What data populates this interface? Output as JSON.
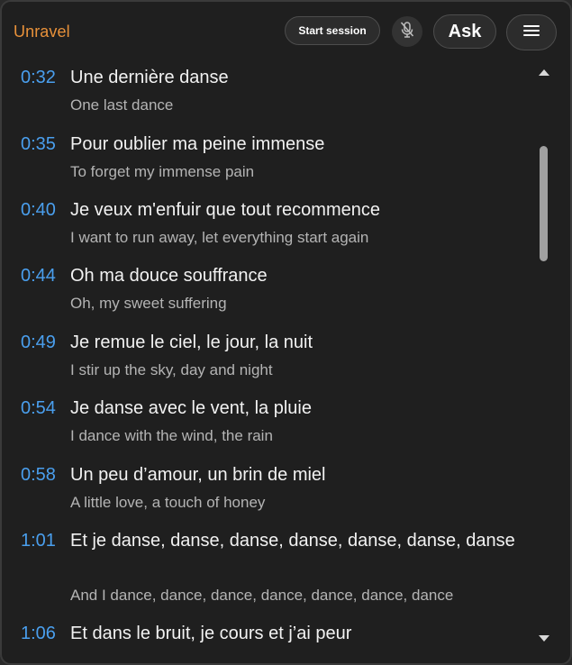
{
  "app": {
    "title": "Unravel"
  },
  "toolbar": {
    "start_session_label": "Start session",
    "mic_icon": "mic-off-icon",
    "ask_label": "Ask",
    "menu_icon": "hamburger-menu-icon"
  },
  "colors": {
    "accent_title": "#e8913a",
    "timestamp": "#4a9fee",
    "background": "#1f1f1f"
  },
  "lyrics": [
    {
      "time": "0:32",
      "original": "Une dernière danse",
      "translation": "One last dance"
    },
    {
      "time": "0:35",
      "original": "Pour oublier ma peine immense",
      "translation": "To forget my immense pain"
    },
    {
      "time": "0:40",
      "original": "Je veux m'enfuir que tout recommence",
      "translation": "I want to run away, let everything start again"
    },
    {
      "time": "0:44",
      "original": "Oh ma douce souffrance",
      "translation": "Oh, my sweet suffering"
    },
    {
      "time": "0:49",
      "original": "Je remue le ciel, le jour, la nuit",
      "translation": "I stir up the sky, day and night"
    },
    {
      "time": "0:54",
      "original": "Je danse avec le vent, la pluie",
      "translation": "I dance with the wind, the rain"
    },
    {
      "time": "0:58",
      "original": "Un peu d’amour, un brin de miel",
      "translation": "A little love, a touch of honey"
    },
    {
      "time": "1:01",
      "original": "Et je danse, danse, danse, danse, danse, danse, danse",
      "translation": "And I dance, dance, dance, dance, dance, dance, dance"
    },
    {
      "time": "1:06",
      "original": "Et dans le bruit, je cours et j’ai peur",
      "translation": ""
    }
  ]
}
